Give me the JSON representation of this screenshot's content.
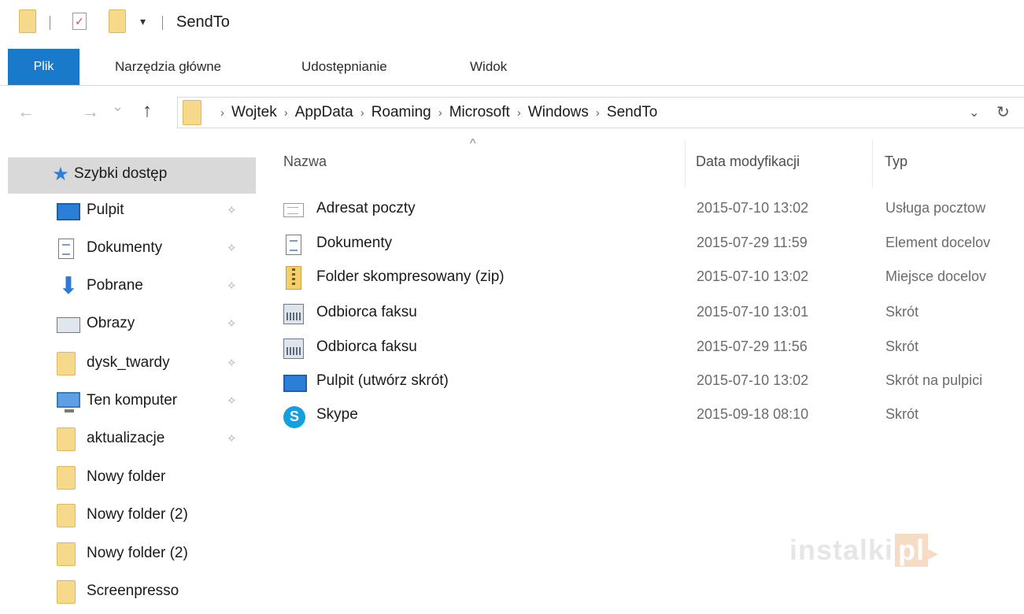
{
  "window": {
    "title": "SendTo",
    "qa_dropdown": "▾"
  },
  "ribbon": {
    "tabs": [
      "Plik",
      "Narzędzia główne",
      "Udostępnianie",
      "Widok"
    ]
  },
  "navigation": {
    "back_icon": "←",
    "forward_icon": "→",
    "recent_icon": "⌄",
    "up_icon": "↑",
    "breadcrumb": [
      "Wojtek",
      "AppData",
      "Roaming",
      "Microsoft",
      "Windows",
      "SendTo"
    ],
    "crumb_separator": "›",
    "dropdown_icon": "⌄",
    "refresh_icon": "↻"
  },
  "sidebar": {
    "items": [
      {
        "label": "Szybki dostęp",
        "icon": "star-icon",
        "pinned": false,
        "active": true
      },
      {
        "label": "Pulpit",
        "icon": "desktop-icon",
        "pinned": true
      },
      {
        "label": "Dokumenty",
        "icon": "documents-icon",
        "pinned": true
      },
      {
        "label": "Pobrane",
        "icon": "downloads-icon",
        "pinned": true
      },
      {
        "label": "Obrazy",
        "icon": "pictures-icon",
        "pinned": true
      },
      {
        "label": "dysk_twardy",
        "icon": "folder-icon",
        "pinned": true
      },
      {
        "label": "Ten komputer",
        "icon": "computer-icon",
        "pinned": true
      },
      {
        "label": "aktualizacje",
        "icon": "folder-icon",
        "pinned": true
      },
      {
        "label": "Nowy folder",
        "icon": "folder-icon",
        "pinned": false
      },
      {
        "label": "Nowy folder (2)",
        "icon": "folder-icon",
        "pinned": false
      },
      {
        "label": "Nowy folder (2)",
        "icon": "folder-icon",
        "pinned": false
      },
      {
        "label": "Screenpresso",
        "icon": "folder-icon",
        "pinned": false
      }
    ],
    "pin_glyph": "✧"
  },
  "file_list": {
    "columns": {
      "name": "Nazwa",
      "date": "Data modyfikacji",
      "type": "Typ"
    },
    "sort_indicator": "^",
    "rows": [
      {
        "name": "Adresat poczty",
        "date": "2015-07-10 13:02",
        "type": "Usługa pocztow",
        "icon": "mail-recipient-icon"
      },
      {
        "name": "Dokumenty",
        "date": "2015-07-29 11:59",
        "type": "Element docelov",
        "icon": "documents-icon"
      },
      {
        "name": "Folder skompresowany (zip)",
        "date": "2015-07-10 13:02",
        "type": "Miejsce docelov",
        "icon": "zip-folder-icon"
      },
      {
        "name": "Odbiorca faksu",
        "date": "2015-07-10 13:01",
        "type": "Skrót",
        "icon": "fax-icon"
      },
      {
        "name": "Odbiorca faksu",
        "date": "2015-07-29 11:56",
        "type": "Skrót",
        "icon": "fax-icon"
      },
      {
        "name": "Pulpit (utwórz skrót)",
        "date": "2015-07-10 13:02",
        "type": "Skrót na pulpici",
        "icon": "desktop-icon"
      },
      {
        "name": "Skype",
        "date": "2015-09-18 08:10",
        "type": "Skrót",
        "icon": "skype-icon"
      }
    ]
  },
  "watermark": {
    "text": "instalki",
    "suffix": "pl",
    "arrow": "▸"
  }
}
